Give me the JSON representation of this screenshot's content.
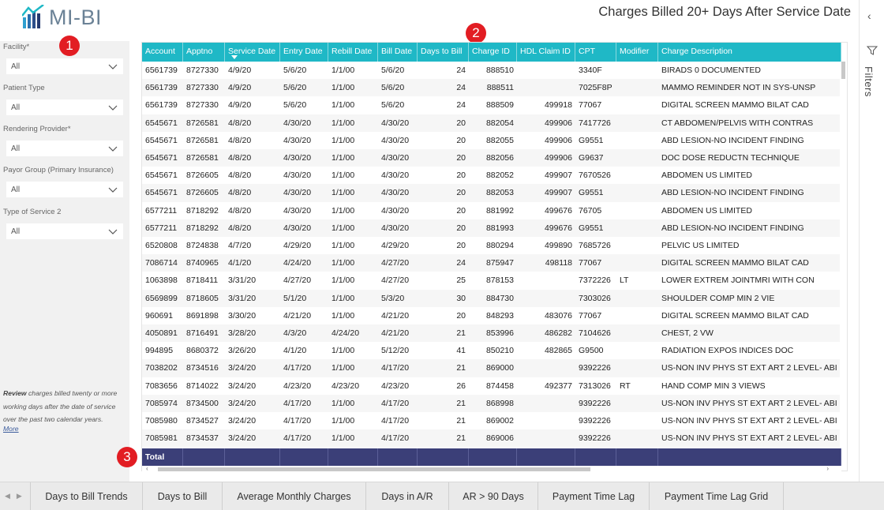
{
  "header": {
    "logo_text": "MI-BI",
    "page_title": "Charges Billed 20+ Days After Service Date"
  },
  "slicers": [
    {
      "label": "Facility*",
      "value": "All"
    },
    {
      "label": "Patient Type",
      "value": "All"
    },
    {
      "label": "Rendering Provider*",
      "value": "All"
    },
    {
      "label": "Payor Group (Primary Insurance)",
      "value": "All"
    },
    {
      "label": "Type of Service 2",
      "value": "All"
    }
  ],
  "review": {
    "bold": "Review",
    "text": " charges billed twenty or more working days after the date of service over the past two calendar years.",
    "more": "More"
  },
  "badges": [
    "1",
    "2",
    "3"
  ],
  "table": {
    "columns": [
      "Account",
      "Apptno",
      "Service Date",
      "Entry Date",
      "Rebill Date",
      "Bill Date",
      "Days to Bill",
      "Charge ID",
      "HDL Claim ID",
      "CPT",
      "Modifier",
      "Charge Description"
    ],
    "rows": [
      [
        "6561739",
        "8727330",
        "4/9/20",
        "5/6/20",
        "1/1/00",
        "5/6/20",
        "24",
        "888510",
        "",
        "3340F",
        "",
        "BIRADS 0 DOCUMENTED"
      ],
      [
        "6561739",
        "8727330",
        "4/9/20",
        "5/6/20",
        "1/1/00",
        "5/6/20",
        "24",
        "888511",
        "",
        "7025F8P",
        "",
        "MAMMO REMINDER NOT IN SYS-UNSP"
      ],
      [
        "6561739",
        "8727330",
        "4/9/20",
        "5/6/20",
        "1/1/00",
        "5/6/20",
        "24",
        "888509",
        "499918",
        "77067",
        "",
        "DIGITAL SCREEN MAMMO BILAT CAD"
      ],
      [
        "6545671",
        "8726581",
        "4/8/20",
        "4/30/20",
        "1/1/00",
        "4/30/20",
        "20",
        "882054",
        "499906",
        "7417726",
        "",
        "CT ABDOMEN/PELVIS WITH CONTRAS"
      ],
      [
        "6545671",
        "8726581",
        "4/8/20",
        "4/30/20",
        "1/1/00",
        "4/30/20",
        "20",
        "882055",
        "499906",
        "G9551",
        "",
        "ABD LESION-NO INCIDENT FINDING"
      ],
      [
        "6545671",
        "8726581",
        "4/8/20",
        "4/30/20",
        "1/1/00",
        "4/30/20",
        "20",
        "882056",
        "499906",
        "G9637",
        "",
        "DOC DOSE REDUCTN TECHNIQUE"
      ],
      [
        "6545671",
        "8726605",
        "4/8/20",
        "4/30/20",
        "1/1/00",
        "4/30/20",
        "20",
        "882052",
        "499907",
        "7670526",
        "",
        "ABDOMEN US LIMITED"
      ],
      [
        "6545671",
        "8726605",
        "4/8/20",
        "4/30/20",
        "1/1/00",
        "4/30/20",
        "20",
        "882053",
        "499907",
        "G9551",
        "",
        "ABD LESION-NO INCIDENT FINDING"
      ],
      [
        "6577211",
        "8718292",
        "4/8/20",
        "4/30/20",
        "1/1/00",
        "4/30/20",
        "20",
        "881992",
        "499676",
        "76705",
        "",
        "ABDOMEN US LIMITED"
      ],
      [
        "6577211",
        "8718292",
        "4/8/20",
        "4/30/20",
        "1/1/00",
        "4/30/20",
        "20",
        "881993",
        "499676",
        "G9551",
        "",
        "ABD LESION-NO INCIDENT FINDING"
      ],
      [
        "6520808",
        "8724838",
        "4/7/20",
        "4/29/20",
        "1/1/00",
        "4/29/20",
        "20",
        "880294",
        "499890",
        "7685726",
        "",
        "PELVIC US LIMITED"
      ],
      [
        "7086714",
        "8740965",
        "4/1/20",
        "4/24/20",
        "1/1/00",
        "4/27/20",
        "24",
        "875947",
        "498118",
        "77067",
        "",
        "DIGITAL SCREEN MAMMO BILAT CAD"
      ],
      [
        "1063898",
        "8718411",
        "3/31/20",
        "4/27/20",
        "1/1/00",
        "4/27/20",
        "25",
        "878153",
        "",
        "7372226",
        "LT",
        "LOWER EXTREM JOINTMRI WITH CON"
      ],
      [
        "6569899",
        "8718605",
        "3/31/20",
        "5/1/20",
        "1/1/00",
        "5/3/20",
        "30",
        "884730",
        "",
        "7303026",
        "",
        "SHOULDER COMP MIN 2 VIE"
      ],
      [
        "960691",
        "8691898",
        "3/30/20",
        "4/21/20",
        "1/1/00",
        "4/21/20",
        "20",
        "848293",
        "483076",
        "77067",
        "",
        "DIGITAL SCREEN MAMMO BILAT CAD"
      ],
      [
        "4050891",
        "8716491",
        "3/28/20",
        "4/3/20",
        "4/24/20",
        "4/21/20",
        "21",
        "853996",
        "486282",
        "7104626",
        "",
        "CHEST, 2 VW"
      ],
      [
        "994895",
        "8680372",
        "3/26/20",
        "4/1/20",
        "1/1/00",
        "5/12/20",
        "41",
        "850210",
        "482865",
        "G9500",
        "",
        "RADIATION EXPOS INDICES DOC"
      ],
      [
        "7038202",
        "8734516",
        "3/24/20",
        "4/17/20",
        "1/1/00",
        "4/17/20",
        "21",
        "869000",
        "",
        "9392226",
        "",
        "US-NON INV PHYS ST EXT ART 2 LEVEL- ABI"
      ],
      [
        "7083656",
        "8714022",
        "3/24/20",
        "4/23/20",
        "4/23/20",
        "4/23/20",
        "26",
        "874458",
        "492377",
        "7313026",
        "RT",
        "HAND COMP MIN 3 VIEWS"
      ],
      [
        "7085974",
        "8734500",
        "3/24/20",
        "4/17/20",
        "1/1/00",
        "4/17/20",
        "21",
        "868998",
        "",
        "9392226",
        "",
        "US-NON INV PHYS ST EXT ART 2 LEVEL- ABI"
      ],
      [
        "7085980",
        "8734527",
        "3/24/20",
        "4/17/20",
        "1/1/00",
        "4/17/20",
        "21",
        "869002",
        "",
        "9392226",
        "",
        "US-NON INV PHYS ST EXT ART 2 LEVEL- ABI"
      ],
      [
        "7085981",
        "8734537",
        "3/24/20",
        "4/17/20",
        "1/1/00",
        "4/17/20",
        "21",
        "869006",
        "",
        "9392226",
        "",
        "US-NON INV PHYS ST EXT ART 2 LEVEL- ABI"
      ]
    ],
    "total_label": "Total"
  },
  "filters_pane": {
    "label": "Filters"
  },
  "tabs": [
    "Days to Bill Trends",
    "Days to Bill",
    "Average Monthly Charges",
    "Days in A/R",
    "AR > 90 Days",
    "Payment Time Lag",
    "Payment Time Lag Grid"
  ],
  "colors": {
    "header_teal": "#1fb8c6",
    "total_navy": "#3b3f78",
    "badge_red": "#e21d23"
  }
}
